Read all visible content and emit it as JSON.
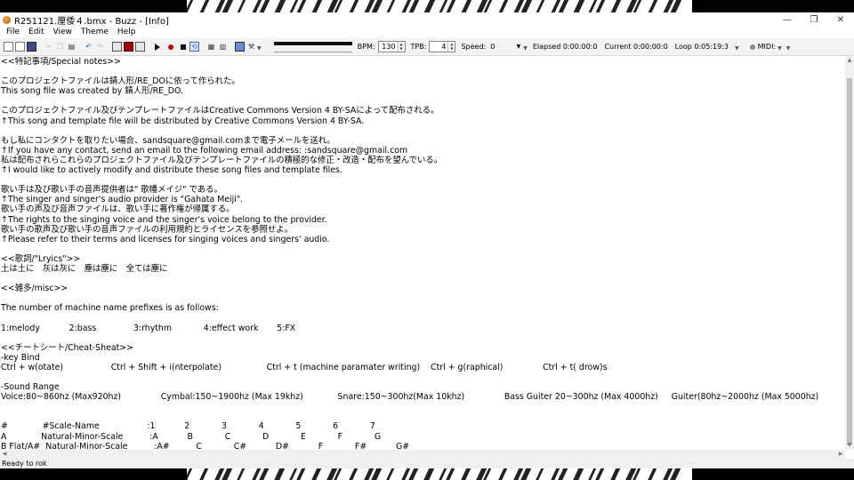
{
  "window": {
    "title": "R251121.厘倭４.bmx - Buzz - [Info]",
    "controls": {
      "minimize": "—",
      "restore": "❐",
      "close": "✕"
    }
  },
  "menu": [
    "File",
    "Edit",
    "View",
    "Theme",
    "Help"
  ],
  "toolbar": {
    "bpm_label": "BPM:",
    "bpm_value": "130",
    "tpb_label": "TPB:",
    "tpb_value": "4",
    "speed_label": "Speed:",
    "speed_value": "0",
    "elapsed": "Elapsed 0:00:00:0",
    "current": "Current 0:00:00:0",
    "loop": "Loop 0:05:19:3",
    "midi_label": "MIDI:"
  },
  "info_lines": [
    "<<特記事項/Special notes>>",
    "",
    "このプロジェクトファイルは錆人形/RE_DOに依って作られた。",
    "This song file was created by 錆人形/RE_DO.",
    "",
    "このプロジェクトファイル及びテンプレートファイルはCreative Commons Version 4 BY-SAによって配布される。",
    "↑This song and template file will be distributed by Creative Commons Version 4 BY-SA.",
    "",
    "もし私にコンタクトを取りたい場合、sandsquare@gmail.comまで電子メールを送れ。",
    "↑If you have any contact, send an email to the following email address: :sandsquare@gmail.com",
    "私は配布されらこれらのプロジェクトファイル及びテンプレートファイルの積極的な修正・改造・配布を望んでいる。",
    "↑I would like to actively modify and distribute these song files and template files.",
    "",
    "歌い手は及び歌い手の音声提供者は\" 歌幡メイジ\" である。",
    "↑The singer and singer's audio provider is \"Gahata Meiji\".",
    "歌い手の声及び音声ファイルは、歌い手に著作権が帰属する。",
    "↑The rights to the singing voice and the singer's voice belong to the provider.",
    "歌い手の歌声及び歌い手の音声ファイルの利用規約とライセンスを参照せよ。",
    "↑Please refer to their terms and licenses for singing voices and singers' audio.",
    "",
    "<<歌詞/\"Lryics\">>",
    "土は土に　灰は灰に　塵は塵に　全ては塵に",
    "",
    "<<雑多/misc>>",
    "",
    "The number of machine name prefixes is as follows:",
    "",
    "1:melody           2:bass              3:rhythm            4:effect work       5:FX",
    "",
    "<<チートシート/Cheat-Sheat>>",
    "-key Bind",
    "Ctrl + w(otate)                  Ctrl + Shift + i(nterpolate)                 Ctrl + t (machine paramater writing)    Ctrl + g(raphical)               Ctrl + t( drow)s",
    "",
    "-Sound Range",
    "Voice:80~860hz (Max920hz)               Cymbal:150~1900hz (Max 19khz)             Snare:150~300hz(Max 10khz)               Bass Guiter 20~300hz (Max 4000hz)     Guiter(80hz~2000hz (Max 5000hz)",
    "",
    "",
    "#             #Scale-Name                  :1           2            3            4            5            6            7",
    "A             Natural-Minor-Scale          :A           B            C            D            E            F            G",
    "B Flat/A#  Natural-Minor-Scale          :A#          C            C#           D#           F            F#           G#"
  ],
  "status": "Ready to rok"
}
